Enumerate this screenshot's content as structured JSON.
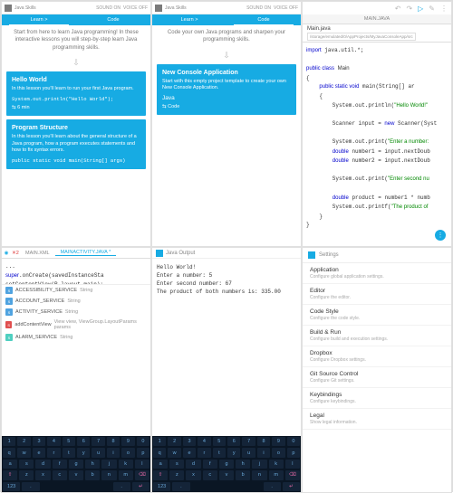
{
  "topbar": {
    "title": "Java Skills",
    "sound": "SOUND ON",
    "voice": "VOICE OFF"
  },
  "learn": {
    "tabs": [
      "Learn >",
      "Code"
    ],
    "intro": "Start from here to learn Java programming! In these interactive lessons you will step-by-step learn Java programming skills.",
    "cards": [
      {
        "title": "Hello World",
        "desc": "In this lesson you'll learn to run your first Java program.",
        "code": "System.out.println(\"Hello World\");",
        "meta": "⇆ 6 min"
      },
      {
        "title": "Program Structure",
        "desc": "In this lesson you'll learn about the general structure of a Java program, how a program executes statements and how to fix syntax errors.",
        "code": "public static void main(String[] args)"
      }
    ]
  },
  "codeTab": {
    "tabs": [
      "Learn >",
      "Code"
    ],
    "intro": "Code your own Java programs and sharpen your programming skills.",
    "card": {
      "title": "New Console Application",
      "desc": "Start with this empty project template to create your own New Console Application.",
      "lang": "Java",
      "action": "⇆ Code"
    }
  },
  "codeview": {
    "tab": "MAIN.JAVA",
    "filename": "Main.java",
    "filepath": "/storage/emulated/0/AppProjects/MyJavaConsoleApp/src",
    "code": "import java.util.*;\n\npublic class Main\n{\n    public static void main(String[] args)\n    {\n        System.out.println(\"Hello World!\");\n\n        Scanner input = new Scanner(System.in);\n\n        System.out.print(\"Enter a number: \");\n        double number1 = input.nextDouble();\n        double number2 = input.nextDouble();\n\n        System.out.print(\"Enter second number: \");\n\n        double product = number1 * number2;\n        System.out.printf(\"The product of ...\");\n    }\n}"
  },
  "editor2": {
    "tabs": [
      "MAIN.XML",
      "MAINACTIVITY.JAVA *"
    ],
    "close": "✕2",
    "code": "...\nsuper.onCreate(savedInstanceState);\nsetContentView(R.layout.main);\nthis.",
    "suggest": [
      {
        "badge": "b-blue",
        "name": "ACCESSIBILITY_SERVICE",
        "type": "String"
      },
      {
        "badge": "b-blue",
        "name": "ACCOUNT_SERVICE",
        "type": "String"
      },
      {
        "badge": "b-blue",
        "name": "ACTIVITY_SERVICE",
        "type": "String"
      },
      {
        "badge": "b-red",
        "name": "addContentView",
        "type": "View view, ViewGroup.LayoutParams params"
      },
      {
        "badge": "b-teal",
        "name": "ALARM_SERVICE",
        "type": "String"
      }
    ]
  },
  "output": {
    "title": "Java Output",
    "text": "Hello World!\nEnter a number: 5\nEnter second number: 67\nThe product of both numbers is: 335.00"
  },
  "settings": {
    "title": "Settings",
    "items": [
      {
        "t": "Application",
        "d": "Configure global application settings."
      },
      {
        "t": "Editor",
        "d": "Configure the editor."
      },
      {
        "t": "Code Style",
        "d": "Configure the code style."
      },
      {
        "t": "Build & Run",
        "d": "Configure build and execution settings."
      },
      {
        "t": "Dropbox",
        "d": "Configure Dropbox settings."
      },
      {
        "t": "Git Source Control",
        "d": "Configure Git settings."
      },
      {
        "t": "Keybindings",
        "d": "Configure keybindings."
      },
      {
        "t": "Legal",
        "d": "Show legal information."
      }
    ]
  },
  "kbd": {
    "r0": [
      "1",
      "2",
      "3",
      "4",
      "5",
      "6",
      "7",
      "8",
      "9",
      "0"
    ],
    "r1": [
      "q",
      "w",
      "e",
      "r",
      "t",
      "y",
      "u",
      "i",
      "o",
      "p"
    ],
    "r2": [
      "a",
      "s",
      "d",
      "f",
      "g",
      "h",
      "j",
      "k",
      "l"
    ],
    "r3": [
      "⇧",
      "z",
      "x",
      "c",
      "v",
      "b",
      "n",
      "m",
      "⌫"
    ],
    "r4": [
      "123",
      ".",
      "␣",
      ".",
      "↵"
    ]
  }
}
